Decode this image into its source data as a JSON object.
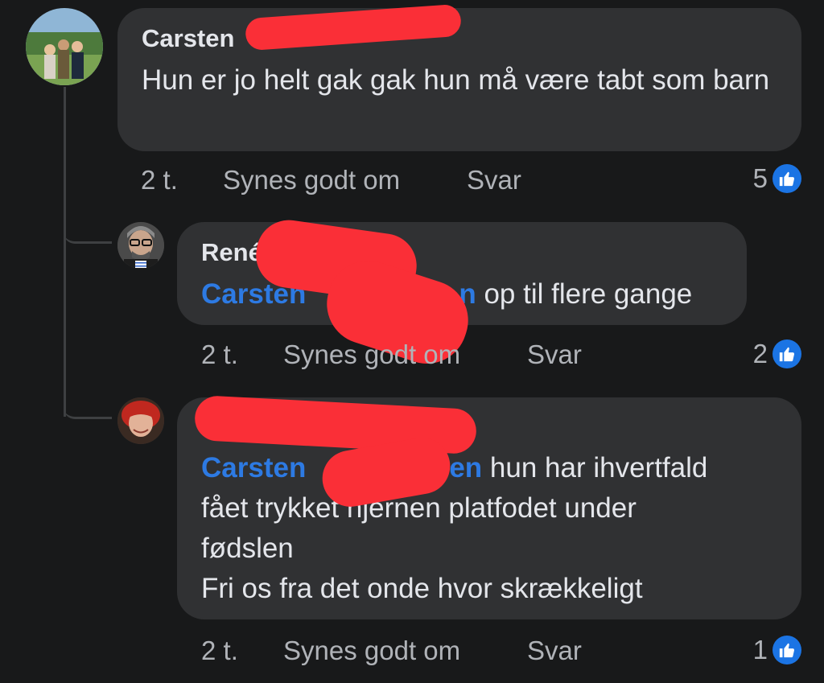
{
  "comments": [
    {
      "author": "Carsten",
      "text": "Hun er jo helt gak gak hun må være tabt som barn",
      "time": "2 t.",
      "like_label": "Synes godt om",
      "reply_label": "Svar",
      "likes": "5",
      "like_icon": "thumbs-up-icon",
      "avatar": "group-photo"
    },
    {
      "author": "René",
      "mention": "Carsten",
      "mention_end": "n",
      "text": "op til flere gange",
      "time": "2 t.",
      "like_label": "Synes godt om",
      "reply_label": "Svar",
      "likes": "2",
      "like_icon": "thumbs-up-icon",
      "avatar": "man-glasses"
    },
    {
      "author": "",
      "mention": "Carsten",
      "mention_end": "en",
      "text_line1": "hun har ihvertfald",
      "text_line2": "fået trykket hjernen platfodet under",
      "text_line3": "fødslen",
      "text_line4": "Fri os fra det onde hvor skrækkeligt",
      "time": "2 t.",
      "like_label": "Synes godt om",
      "reply_label": "Svar",
      "likes": "1",
      "like_icon": "thumbs-up-icon",
      "avatar": "woman-red-hair"
    }
  ],
  "colors": {
    "background": "#18191a",
    "bubble": "#303133",
    "mention": "#2d7ae3",
    "like_badge": "#1b74e4",
    "redaction": "#fa2f37"
  }
}
